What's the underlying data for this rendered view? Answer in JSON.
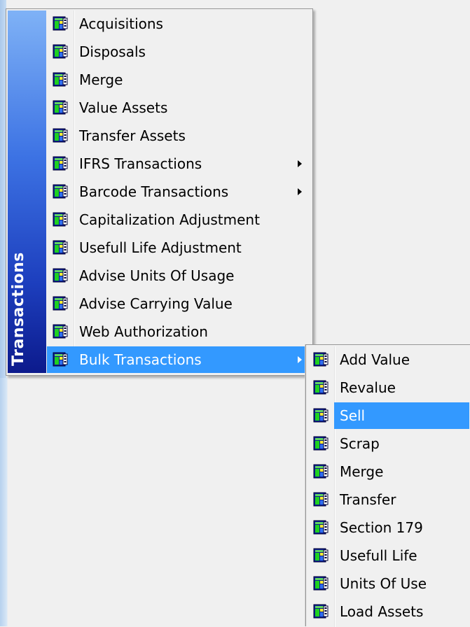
{
  "menu": {
    "side_label": "Transactions",
    "items": [
      {
        "label": "Acquisitions",
        "icon": "transaction-icon",
        "submenu": false,
        "highlighted": false
      },
      {
        "label": "Disposals",
        "icon": "transaction-icon",
        "submenu": false,
        "highlighted": false
      },
      {
        "label": "Merge",
        "icon": "transaction-icon",
        "submenu": false,
        "highlighted": false
      },
      {
        "label": "Value Assets",
        "icon": "transaction-icon",
        "submenu": false,
        "highlighted": false
      },
      {
        "label": "Transfer Assets",
        "icon": "transaction-icon",
        "submenu": false,
        "highlighted": false
      },
      {
        "label": "IFRS Transactions",
        "icon": "transaction-icon",
        "submenu": true,
        "highlighted": false
      },
      {
        "label": "Barcode Transactions",
        "icon": "transaction-icon",
        "submenu": true,
        "highlighted": false
      },
      {
        "label": "Capitalization Adjustment",
        "icon": "transaction-icon",
        "submenu": false,
        "highlighted": false
      },
      {
        "label": "Usefull Life Adjustment",
        "icon": "transaction-icon",
        "submenu": false,
        "highlighted": false
      },
      {
        "label": "Advise Units Of Usage",
        "icon": "transaction-icon",
        "submenu": false,
        "highlighted": false
      },
      {
        "label": "Advise Carrying Value",
        "icon": "transaction-icon",
        "submenu": false,
        "highlighted": false
      },
      {
        "label": "Web Authorization",
        "icon": "transaction-icon",
        "submenu": false,
        "highlighted": false
      },
      {
        "label": "Bulk Transactions",
        "icon": "transaction-icon",
        "submenu": true,
        "highlighted": true
      }
    ]
  },
  "submenu": {
    "items": [
      {
        "label": "Add Value",
        "icon": "transaction-icon",
        "highlighted": false
      },
      {
        "label": "Revalue",
        "icon": "transaction-icon",
        "highlighted": false
      },
      {
        "label": "Sell",
        "icon": "transaction-icon",
        "highlighted": true
      },
      {
        "label": "Scrap",
        "icon": "transaction-icon",
        "highlighted": false
      },
      {
        "label": "Merge",
        "icon": "transaction-icon",
        "highlighted": false
      },
      {
        "label": "Transfer",
        "icon": "transaction-icon",
        "highlighted": false
      },
      {
        "label": "Section 179",
        "icon": "transaction-icon",
        "highlighted": false
      },
      {
        "label": "Usefull Life",
        "icon": "transaction-icon",
        "highlighted": false
      },
      {
        "label": "Units Of Use",
        "icon": "transaction-icon",
        "highlighted": false
      },
      {
        "label": "Load Assets",
        "icon": "transaction-icon",
        "highlighted": false
      }
    ]
  },
  "colors": {
    "highlight": "#3399ff",
    "menu_bg": "#f0f0f0",
    "banner_top": "#7fb2f6",
    "banner_bottom": "#0c1a8c"
  }
}
